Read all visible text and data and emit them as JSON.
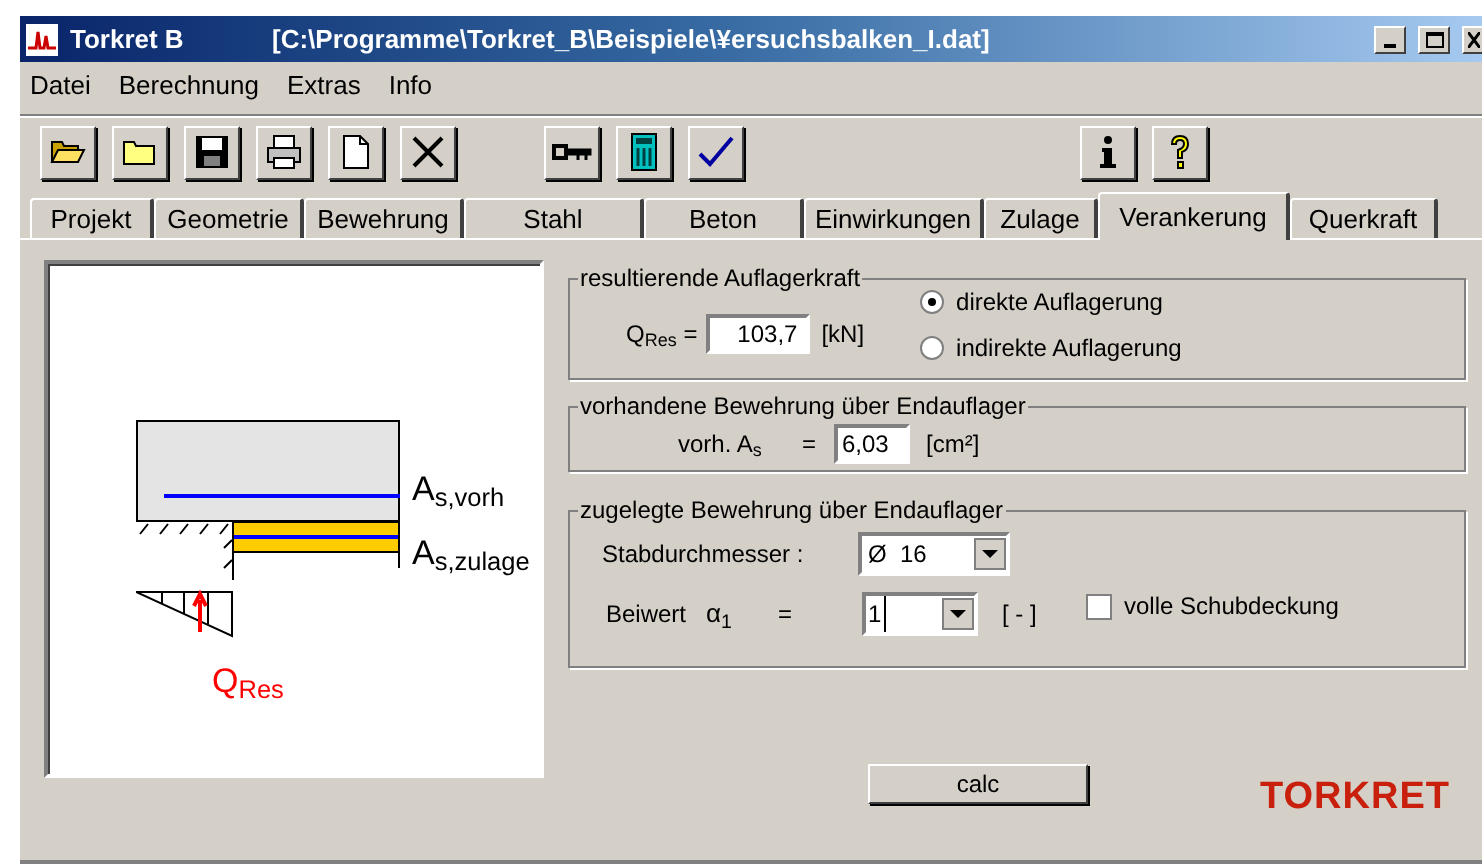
{
  "window": {
    "app_name": "Torkret B",
    "file_path": "[C:\\Programme\\Torkret_B\\Beispiele\\¥ersuchsbalken_I.dat]"
  },
  "menu": [
    "Datei",
    "Berechnung",
    "Extras",
    "Info"
  ],
  "toolbar": [
    {
      "kind": "open"
    },
    {
      "kind": "folder"
    },
    {
      "kind": "save"
    },
    {
      "kind": "print"
    },
    {
      "kind": "new"
    },
    {
      "kind": "delete"
    },
    {
      "kind": "gap"
    },
    {
      "kind": "key"
    },
    {
      "kind": "calculator"
    },
    {
      "kind": "check"
    },
    {
      "kind": "spacer"
    },
    {
      "kind": "info"
    },
    {
      "kind": "help"
    }
  ],
  "tabs": [
    {
      "label": "Projekt",
      "selected": false
    },
    {
      "label": "Geometrie",
      "selected": false
    },
    {
      "label": "Bewehrung",
      "selected": false
    },
    {
      "label": "Stahl",
      "selected": false
    },
    {
      "label": "Beton",
      "selected": false
    },
    {
      "label": "Einwirkungen",
      "selected": false
    },
    {
      "label": "Zulage",
      "selected": false
    },
    {
      "label": "Verankerung",
      "selected": true
    },
    {
      "label": "Querkraft",
      "selected": false
    }
  ],
  "diagram": {
    "label_existing": "A$_{s,vorh}$",
    "label_added": "A$_{s,zulage}$",
    "label_force": "Q$_{Res}$"
  },
  "support_force": {
    "title": "resultierende Auflagerkraft",
    "label": "Q$_{Res}$ =",
    "value": "103,7",
    "unit": "[kN]",
    "options": [
      {
        "label": "direkte Auflagerung",
        "selected": true
      },
      {
        "label": "indirekte Auflagerung",
        "selected": false
      }
    ]
  },
  "existing_reinforcement": {
    "title": "vorhandene Bewehrung über Endauflager",
    "label": "vorh.  A$_{s}$",
    "equals": "=",
    "value": "6,03",
    "unit": "[cm²]"
  },
  "added_reinforcement": {
    "title": "zugelegte Bewehrung über Endauflager",
    "diameter_label": "Stabdurchmesser :",
    "diameter_value": "Ø  16",
    "coefficient_label": "Beiwert",
    "coefficient_symbol": "α$_{1}$",
    "equals": "=",
    "coefficient_value": "1",
    "coefficient_unit": "[ - ]",
    "full_shear_coverage": {
      "label": "volle Schubdeckung",
      "checked": false
    }
  },
  "calc_button": "calc",
  "logo": "TORKRET"
}
